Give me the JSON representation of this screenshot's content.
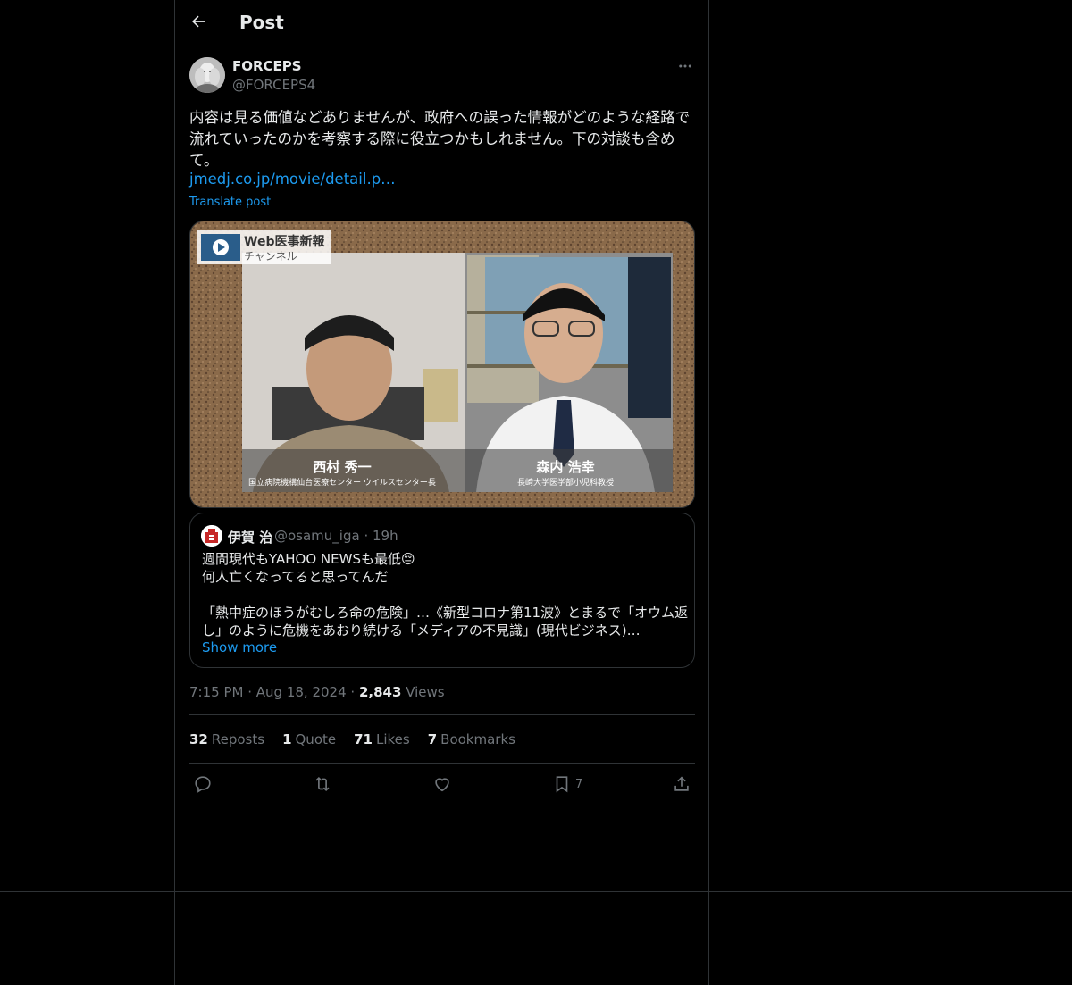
{
  "header": {
    "title": "Post"
  },
  "author": {
    "name": "FORCEPS",
    "handle": "@FORCEPS4"
  },
  "post": {
    "text": "内容は見る価値などありませんが、政府への誤った情報がどのような経路で流れていったのかを考察する際に役立つかもしれません。下の対談も含めて。",
    "link": "jmedj.co.jp/movie/detail.p…",
    "translate": "Translate post"
  },
  "media": {
    "logo_title": "Web医事新報",
    "logo_sub": "チャンネル",
    "left_name": "西村 秀一",
    "left_role": "国立病院機構仙台医療センター ウイルスセンター長",
    "right_name": "森内 浩幸",
    "right_role": "長崎大学医学部小児科教授"
  },
  "quote": {
    "name": "伊賀 治",
    "handle": "@osamu_iga · 19h",
    "text": "週間現代もYAHOO NEWSも最低😔\n何人亡くなってると思ってんだ\n\n「熱中症のほうがむしろ命の危険」…《新型コロナ第11波》とまるで「オウム返し」のように危機をあおり続ける「メディアの不見識」(現代ビジネス)…",
    "show_more": "Show more"
  },
  "meta": {
    "time": "7:15 PM",
    "date": "Aug 18, 2024",
    "views_count": "2,843",
    "views_label": "Views"
  },
  "stats": {
    "reposts_count": "32",
    "reposts_label": "Reposts",
    "quotes_count": "1",
    "quotes_label": "Quote",
    "likes_count": "71",
    "likes_label": "Likes",
    "bookmarks_count": "7",
    "bookmarks_label": "Bookmarks"
  },
  "actions": {
    "bookmark_count": "7"
  },
  "icons": [
    "back-arrow-icon",
    "more-icon",
    "reply-icon",
    "repost-icon",
    "like-icon",
    "bookmark-icon",
    "share-icon"
  ]
}
